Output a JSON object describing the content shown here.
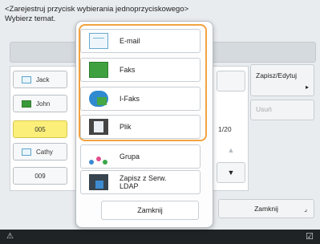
{
  "header": {
    "line1": "<Zarejestruj przycisk wybierania jednoprzyciskowego>",
    "line2": "Wybierz temat."
  },
  "list": {
    "rows": [
      {
        "label": "Jack",
        "icon": "mail-icon",
        "selected": false
      },
      {
        "label": "John",
        "icon": "fax-icon",
        "selected": false
      },
      {
        "label": "005",
        "icon": "",
        "selected": true
      },
      {
        "label": "Cathy",
        "icon": "mail-icon",
        "selected": false
      },
      {
        "label": "009",
        "icon": "",
        "selected": false
      }
    ],
    "counter": "1/20"
  },
  "right": {
    "save_edit": "Zapisz/Edytuj",
    "delete": "Usuń",
    "close": "Zamknij"
  },
  "popup": {
    "options": [
      {
        "label": "E-mail",
        "icon": "email-icon"
      },
      {
        "label": "Faks",
        "icon": "fax-icon"
      },
      {
        "label": "I-Faks",
        "icon": "ifax-icon"
      },
      {
        "label": "Plik",
        "icon": "file-icon"
      },
      {
        "label": "Grupa",
        "icon": "group-icon"
      },
      {
        "label": "Zapisz z Serw. LDAP",
        "icon": "ldap-icon"
      }
    ],
    "close": "Zamknij"
  },
  "colors": {
    "highlight": "#f2a341",
    "selected_row": "#fbef7a",
    "status_bar": "#1f2326"
  }
}
